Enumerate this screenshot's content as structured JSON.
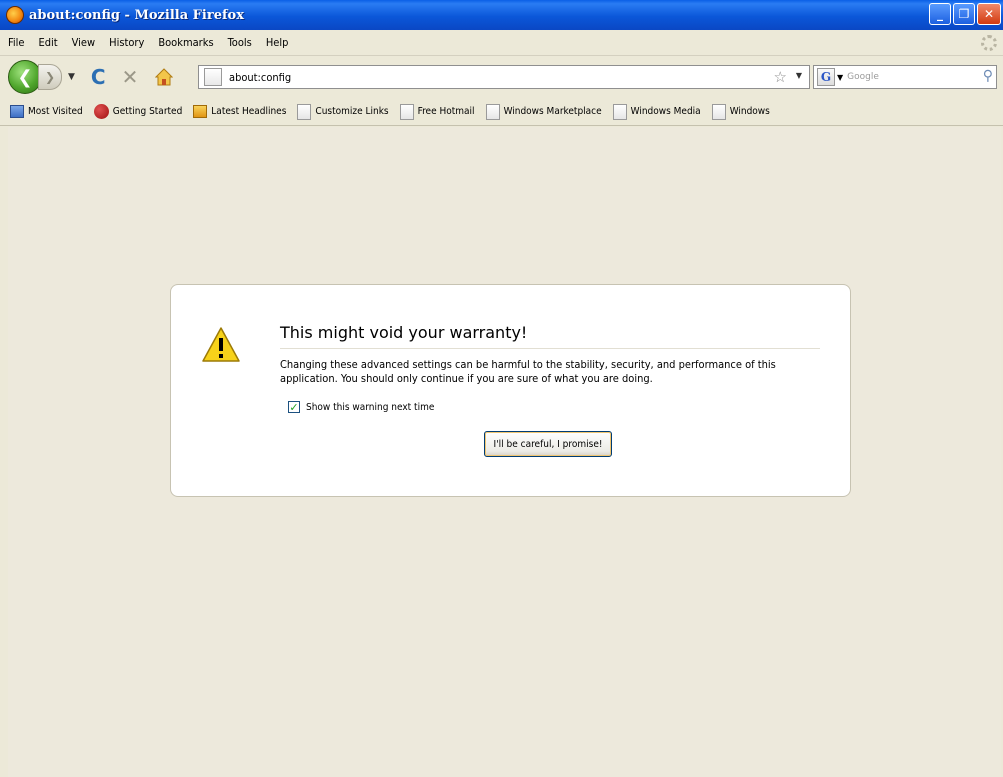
{
  "window": {
    "title": "about:config - Mozilla Firefox",
    "controls": [
      "_",
      "❐",
      "✕"
    ]
  },
  "menu": [
    {
      "label": "File"
    },
    {
      "label": "Edit"
    },
    {
      "label": "View"
    },
    {
      "label": "History"
    },
    {
      "label": "Bookmarks"
    },
    {
      "label": "Tools"
    },
    {
      "label": "Help"
    }
  ],
  "nav": {
    "url": "about:config",
    "search_placeholder": "Google",
    "search_engine_letter": "G"
  },
  "bookmarks": [
    {
      "label": "Most Visited",
      "icon": "folder-blue"
    },
    {
      "label": "Getting Started",
      "icon": "firefox"
    },
    {
      "label": "Latest Headlines",
      "icon": "rss"
    },
    {
      "label": "Customize Links",
      "icon": "page"
    },
    {
      "label": "Free Hotmail",
      "icon": "page"
    },
    {
      "label": "Windows Marketplace",
      "icon": "page"
    },
    {
      "label": "Windows Media",
      "icon": "page"
    },
    {
      "label": "Windows",
      "icon": "page"
    }
  ],
  "warning": {
    "title": "This might void your warranty!",
    "description": "Changing these advanced settings can be harmful to the stability, security, and performance of this application. You should only continue if you are sure of what you are doing.",
    "checkbox_label": "Show this warning next time",
    "checkbox_checked": true,
    "button_label": "I'll be careful, I promise!"
  }
}
